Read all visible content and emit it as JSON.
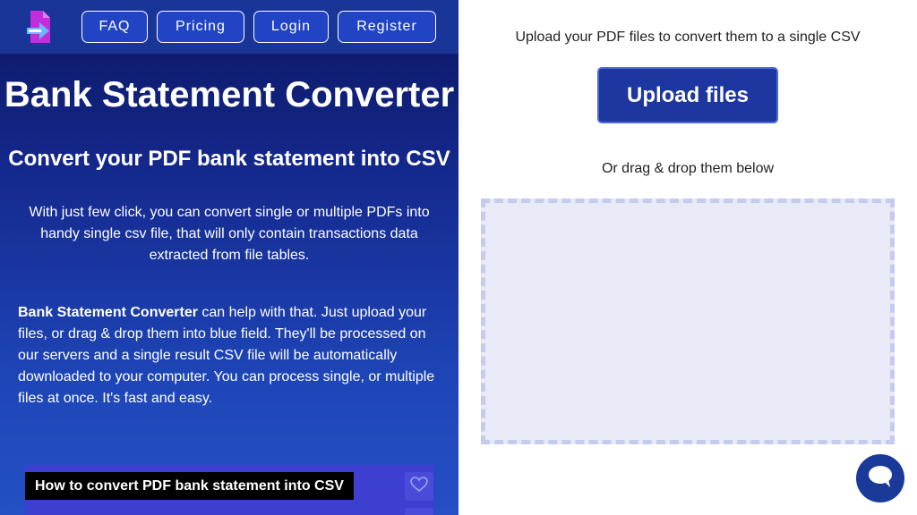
{
  "nav": {
    "items": [
      {
        "label": "FAQ"
      },
      {
        "label": "Pricing"
      },
      {
        "label": "Login"
      },
      {
        "label": "Register"
      }
    ],
    "logo_icon": "file-convert-icon"
  },
  "hero": {
    "title": "Bank Statement Converter",
    "subtitle": "Convert your PDF bank statement into CSV",
    "intro": "With just few click, you can convert single or multiple PDFs into handy single csv file, that will only contain transactions data extracted from file tables.",
    "desc_bold": "Bank Statement Converter",
    "desc_rest": " can help with that. Just upload your files, or drag & drop them into blue field. They'll be processed on our servers and a single result CSV file will be automatically downloaded to your computer. You can process single, or multiple files at once. It's fast and easy."
  },
  "video": {
    "title": "How to convert PDF bank statement into CSV",
    "like_icon": "heart-icon"
  },
  "upload": {
    "instruction": "Upload your PDF files to convert them to a single CSV",
    "button_label": "Upload files",
    "drag_text": "Or drag & drop them below"
  },
  "chat": {
    "icon": "chat-bubble-icon"
  },
  "colors": {
    "accent": "#1e36a0",
    "nav_bg": "#1a3598",
    "dropzone_bg": "#e8eaf8"
  }
}
